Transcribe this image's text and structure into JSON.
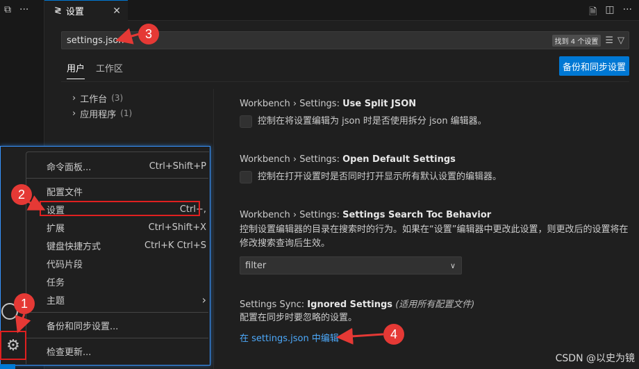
{
  "editor_tab": {
    "icon": "settings-sliders-icon",
    "label": "设置",
    "close": "✕"
  },
  "top_left": {
    "icon1": "restore-icon",
    "icon2": "more-icon"
  },
  "tab_actions": [
    "open-json-icon",
    "split-editor-icon",
    "more-icon"
  ],
  "search": {
    "value": "settings.json",
    "count": "找到 4 个设置"
  },
  "scope_tabs": {
    "user": "用户",
    "workspace": "工作区"
  },
  "backup_button": "备份和同步设置",
  "toc": [
    {
      "label": "工作台",
      "count": "(3)"
    },
    {
      "label": "应用程序",
      "count": "(1)"
    }
  ],
  "settings": [
    {
      "prefix": "Workbench › Settings: ",
      "name": "Use Split JSON",
      "desc": "控制在将设置编辑为 json 时是否使用拆分 json 编辑器。"
    },
    {
      "prefix": "Workbench › Settings: ",
      "name": "Open Default Settings",
      "desc": "控制在打开设置时是否同时打开显示所有默认设置的编辑器。"
    },
    {
      "prefix": "Workbench › Settings: ",
      "name": "Settings Search Toc Behavior",
      "desc": "控制设置编辑器的目录在搜索时的行为。如果在“设置”编辑器中更改此设置，则更改后的设置将在修改搜索查询后生效。",
      "value": "filter"
    },
    {
      "prefix": "Settings Sync: ",
      "name": "Ignored Settings",
      "scope": "(适用所有配置文件)",
      "desc": "配置在同步时要忽略的设置。",
      "link": "在 settings.json 中编辑"
    }
  ],
  "menu": [
    {
      "label": "命令面板...",
      "kb": "Ctrl+Shift+P"
    },
    {
      "label": "配置文件",
      "kb": ""
    },
    {
      "label": "设置",
      "kb": "Ctrl+,"
    },
    {
      "label": "扩展",
      "kb": "Ctrl+Shift+X"
    },
    {
      "label": "键盘快捷方式",
      "kb": "Ctrl+K Ctrl+S"
    },
    {
      "label": "代码片段",
      "kb": ""
    },
    {
      "label": "任务",
      "kb": ""
    },
    {
      "label": "主题",
      "kb": "›"
    },
    {
      "label": "备份和同步设置...",
      "kb": ""
    },
    {
      "label": "检查更新...",
      "kb": ""
    }
  ],
  "annotations": [
    "1",
    "2",
    "3",
    "4"
  ],
  "watermark": "CSDN @以史为镜",
  "colors": {
    "accent": "#0078d4",
    "annotation": "#e53935",
    "link": "#4daafc"
  }
}
